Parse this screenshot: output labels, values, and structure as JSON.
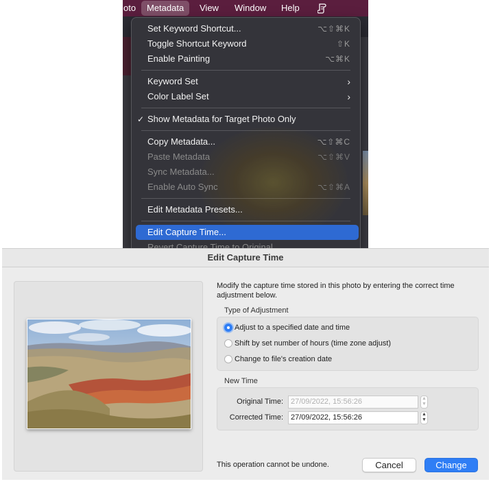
{
  "menubar": {
    "items": [
      "oto",
      "Metadata",
      "View",
      "Window",
      "Help"
    ],
    "active_item": "Metadata"
  },
  "menu": {
    "items": [
      {
        "label": "Set Keyword Shortcut...",
        "shortcut": "⌥⇧⌘K"
      },
      {
        "label": "Toggle Shortcut Keyword",
        "shortcut": "⇧K"
      },
      {
        "label": "Enable Painting",
        "shortcut": "⌥⌘K"
      },
      {
        "label": "Keyword Set",
        "submenu": true
      },
      {
        "label": "Color Label Set",
        "submenu": true
      },
      {
        "label": "Show Metadata for Target Photo Only",
        "checked": true
      },
      {
        "label": "Copy Metadata...",
        "shortcut": "⌥⇧⌘C"
      },
      {
        "label": "Paste Metadata",
        "shortcut": "⌥⇧⌘V",
        "disabled": true
      },
      {
        "label": "Sync Metadata...",
        "disabled": true
      },
      {
        "label": "Enable Auto Sync",
        "shortcut": "⌥⇧⌘A",
        "disabled": true
      },
      {
        "label": "Edit Metadata Presets..."
      },
      {
        "label": "Edit Capture Time...",
        "highlighted": true
      },
      {
        "label": "Revert Capture Time to Original",
        "disabled": true
      }
    ],
    "check_glyph": "✓",
    "submenu_glyph": "›",
    "highlight_color": "#2e6ad3"
  },
  "dialog": {
    "title": "Edit Capture Time",
    "description": "Modify the capture time stored in this photo by entering the correct time adjustment below.",
    "adjustment": {
      "title": "Type of Adjustment",
      "options": [
        {
          "label": "Adjust to a specified date and time",
          "selected": true
        },
        {
          "label": "Shift by set number of hours (time zone adjust)",
          "selected": false
        },
        {
          "label": "Change to file's creation date",
          "selected": false
        }
      ]
    },
    "new_time": {
      "title": "New Time",
      "original_label": "Original Time:",
      "original_value": "27/09/2022,  15:56:26",
      "corrected_label": "Corrected Time:",
      "corrected_value": "27/09/2022,  15:56:26"
    },
    "footnote": "This operation cannot be undone.",
    "cancel_label": "Cancel",
    "change_label": "Change",
    "accent_color": "#2f7ef5"
  }
}
